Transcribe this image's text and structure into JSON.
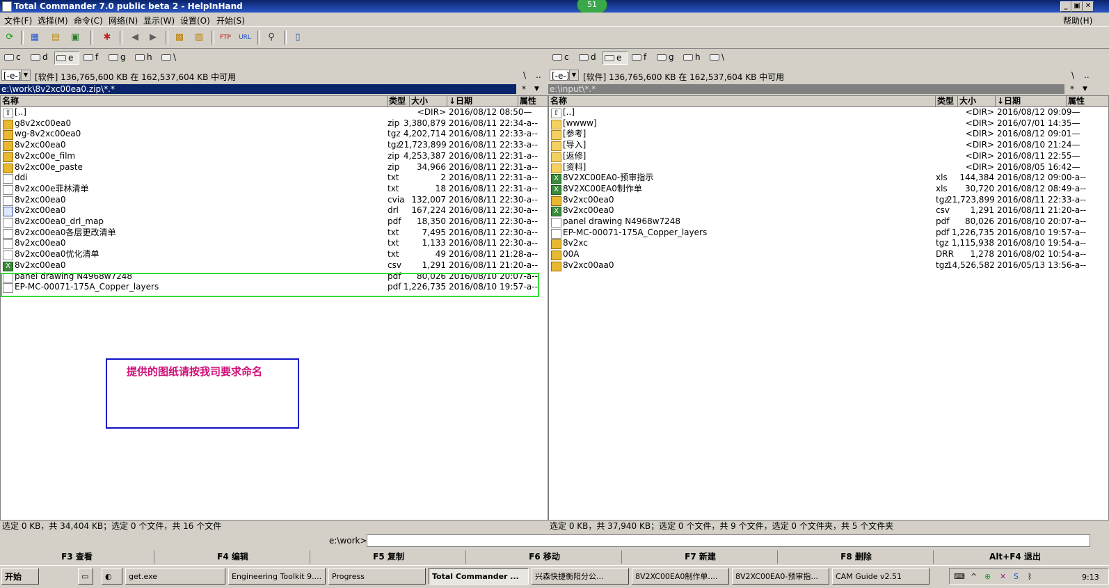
{
  "window": {
    "title": "Total Commander 7.0 public beta 2 - HelpInHand",
    "badge": "51",
    "min": "_",
    "restore": "▣",
    "close": "✕"
  },
  "menu": {
    "items": [
      "文件(F)",
      "选择(M)",
      "命令(C)",
      "网络(N)",
      "显示(W)",
      "设置(O)",
      "开始(S)"
    ],
    "help": "帮助(H)"
  },
  "drives": [
    "c",
    "d",
    "e",
    "f",
    "g",
    "h",
    "\\"
  ],
  "left": {
    "drive_combo": "[-e-]",
    "free_text": "[软件]  136,765,600 KB 在 162,537,604 KB 中可用",
    "root_btn": "\\",
    "up_btn": "..",
    "path": "e:\\work\\8v2xc00ea0.zip\\*.*",
    "path_star": "*",
    "path_arrow": "▼",
    "headers": {
      "name": "名称",
      "ext": "类型",
      "size": "大小",
      "date": "↓日期",
      "attr": "属性"
    },
    "rows": [
      {
        "icon": "up",
        "name": "[..]",
        "ext": "",
        "size": "<DIR>",
        "date": "2016/08/12 08:50—"
      },
      {
        "icon": "zip",
        "name": "g8v2xc00ea0",
        "ext": "zip",
        "size": "3,380,879",
        "date": "2016/08/11 22:34-a--"
      },
      {
        "icon": "zip",
        "name": "wg-8v2xc00ea0",
        "ext": "tgz",
        "size": "4,202,714",
        "date": "2016/08/11 22:33-a--"
      },
      {
        "icon": "zip",
        "name": "8v2xc00ea0",
        "ext": "tgz",
        "size": "21,723,899",
        "date": "2016/08/11 22:33-a--"
      },
      {
        "icon": "zip",
        "name": "8v2xc00e_film",
        "ext": "zip",
        "size": "4,253,387",
        "date": "2016/08/11 22:31-a--"
      },
      {
        "icon": "zip",
        "name": "8v2xc00e_paste",
        "ext": "zip",
        "size": "34,966",
        "date": "2016/08/11 22:31-a--"
      },
      {
        "icon": "doc",
        "name": "ddi",
        "ext": "txt",
        "size": "2",
        "date": "2016/08/11 22:31-a--"
      },
      {
        "icon": "doc",
        "name": "8v2xc00e菲林清单",
        "ext": "txt",
        "size": "18",
        "date": "2016/08/11 22:31-a--"
      },
      {
        "icon": "doc",
        "name": "8v2xc00ea0",
        "ext": "cvia",
        "size": "132,007",
        "date": "2016/08/11 22:30-a--"
      },
      {
        "icon": "drl",
        "name": "8v2xc00ea0",
        "ext": "drl",
        "size": "167,224",
        "date": "2016/08/11 22:30-a--"
      },
      {
        "icon": "doc",
        "name": "8v2xc00ea0_drl_map",
        "ext": "pdf",
        "size": "18,350",
        "date": "2016/08/11 22:30-a--"
      },
      {
        "icon": "doc",
        "name": "8v2xc00ea0各层更改清单",
        "ext": "txt",
        "size": "7,495",
        "date": "2016/08/11 22:30-a--"
      },
      {
        "icon": "doc",
        "name": "8v2xc00ea0",
        "ext": "txt",
        "size": "1,133",
        "date": "2016/08/11 22:30-a--"
      },
      {
        "icon": "doc",
        "name": "8v2xc00ea0优化清单",
        "ext": "txt",
        "size": "49",
        "date": "2016/08/11 21:28-a--"
      },
      {
        "icon": "csv",
        "name": "8v2xc00ea0",
        "ext": "csv",
        "size": "1,291",
        "date": "2016/08/11 21:20-a--"
      },
      {
        "icon": "doc",
        "name": "panel drawing N4968w7248",
        "ext": "pdf",
        "size": "80,026",
        "date": "2016/08/10 20:07-a--"
      },
      {
        "icon": "doc",
        "name": "EP-MC-00071-175A_Copper_layers",
        "ext": "pdf",
        "size": "1,226,735",
        "date": "2016/08/10 19:57-a--"
      }
    ],
    "status": "选定 0 KB，共 34,404 KB；选定 0 个文件，共 16 个文件"
  },
  "right": {
    "drive_combo": "[-e-]",
    "free_text": "[软件]  136,765,600 KB 在 162,537,604 KB 中可用",
    "root_btn": "\\",
    "up_btn": "..",
    "path": "e:\\input\\*.*",
    "path_star": "*",
    "path_arrow": "▼",
    "headers": {
      "name": "名称",
      "ext": "类型",
      "size": "大小",
      "date": "↓日期",
      "attr": "属性"
    },
    "rows": [
      {
        "icon": "up",
        "name": "[..]",
        "ext": "",
        "size": "<DIR>",
        "date": "2016/08/12 09:09—"
      },
      {
        "icon": "dir",
        "name": "[wwww]",
        "ext": "",
        "size": "<DIR>",
        "date": "2016/07/01 14:35—"
      },
      {
        "icon": "dir",
        "name": "[参考]",
        "ext": "",
        "size": "<DIR>",
        "date": "2016/08/12 09:01—"
      },
      {
        "icon": "dir",
        "name": "[导入]",
        "ext": "",
        "size": "<DIR>",
        "date": "2016/08/10 21:24—"
      },
      {
        "icon": "dir",
        "name": "[返修]",
        "ext": "",
        "size": "<DIR>",
        "date": "2016/08/11 22:55—"
      },
      {
        "icon": "dir",
        "name": "[资料]",
        "ext": "",
        "size": "<DIR>",
        "date": "2016/08/05 16:42—"
      },
      {
        "icon": "xls",
        "name": "8V2XC00EA0-预审指示",
        "ext": "xls",
        "size": "144,384",
        "date": "2016/08/12 09:00-a--"
      },
      {
        "icon": "xls",
        "name": "8V2XC00EA0制作单",
        "ext": "xls",
        "size": "30,720",
        "date": "2016/08/12 08:49-a--"
      },
      {
        "icon": "zip",
        "name": "8v2xc00ea0",
        "ext": "tgz",
        "size": "21,723,899",
        "date": "2016/08/11 22:33-a--"
      },
      {
        "icon": "csv",
        "name": "8v2xc00ea0",
        "ext": "csv",
        "size": "1,291",
        "date": "2016/08/11 21:20-a--"
      },
      {
        "icon": "doc",
        "name": "panel drawing N4968w7248",
        "ext": "pdf",
        "size": "80,026",
        "date": "2016/08/10 20:07-a--"
      },
      {
        "icon": "doc",
        "name": "EP-MC-00071-175A_Copper_layers",
        "ext": "pdf",
        "size": "1,226,735",
        "date": "2016/08/10 19:57-a--"
      },
      {
        "icon": "zip",
        "name": "8v2xc",
        "ext": "tgz",
        "size": "1,115,938",
        "date": "2016/08/10 19:54-a--"
      },
      {
        "icon": "zip",
        "name": "00A",
        "ext": "DRR",
        "size": "1,278",
        "date": "2016/08/02 10:54-a--"
      },
      {
        "icon": "zip",
        "name": "8v2xc00aa0",
        "ext": "tgz",
        "size": "14,526,582",
        "date": "2016/05/13 13:56-a--"
      }
    ],
    "status": "选定 0 KB，共 37,940 KB；选定 0 个文件，共 9 个文件，选定 0 个文件夹，共 5 个文件夹"
  },
  "annotation": {
    "note": "提供的图纸请按我司要求命名",
    "highlight_color": "#33dd33",
    "box_color": "#1010c8",
    "note_color": "#d0107a"
  },
  "cmdline": {
    "label": "e:\\work>",
    "value": ""
  },
  "fkeys": [
    "F3 查看",
    "F4 编辑",
    "F5 复制",
    "F6 移动",
    "F7 新建",
    "F8 删除",
    "Alt+F4 退出"
  ],
  "taskbar": {
    "start": "开始",
    "tasks": [
      {
        "label": "get.exe",
        "active": false
      },
      {
        "label": "Engineering Toolkit 9....",
        "active": false
      },
      {
        "label": "Progress",
        "active": false
      },
      {
        "label": "Total Commander ...",
        "active": true
      },
      {
        "label": "兴森快捷衡阳分公...",
        "active": false
      },
      {
        "label": "8V2XC00EA0制作单....",
        "active": false
      },
      {
        "label": "8V2XC00EA0-预审指...",
        "active": false
      },
      {
        "label": "CAM  Guide v2.51",
        "active": false
      }
    ],
    "clock": "9:13"
  }
}
